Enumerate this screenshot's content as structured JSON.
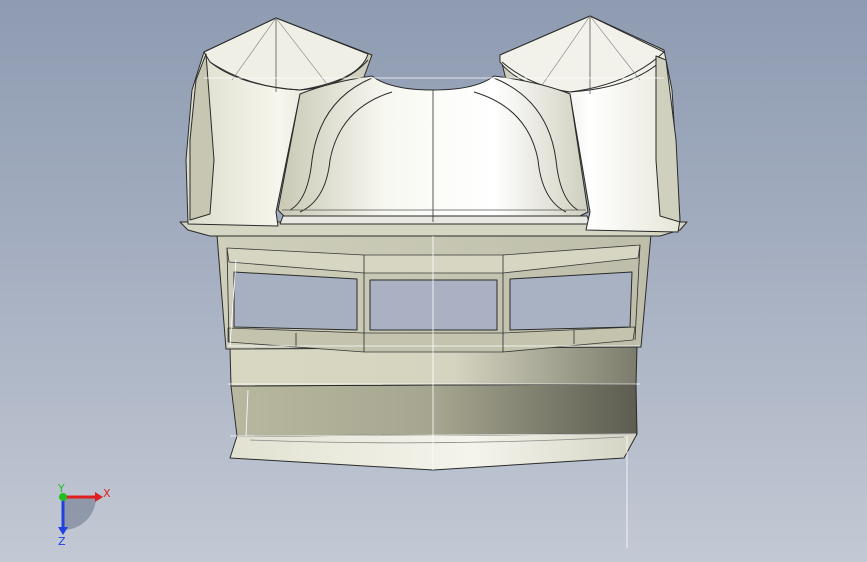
{
  "viewport": {
    "background_top": "#8e9bb1",
    "background_bottom": "#c3c9d4"
  },
  "model": {
    "surface_light": "#f7f7f2",
    "surface_mid": "#d8d8c6",
    "surface_dark": "#6b6b5e",
    "edge_color": "#202020"
  },
  "triad": {
    "x_label": "X",
    "y_label": "Y",
    "z_label": "Z",
    "x_color": "#e02020",
    "y_color": "#20c020",
    "z_color": "#2040e0"
  }
}
